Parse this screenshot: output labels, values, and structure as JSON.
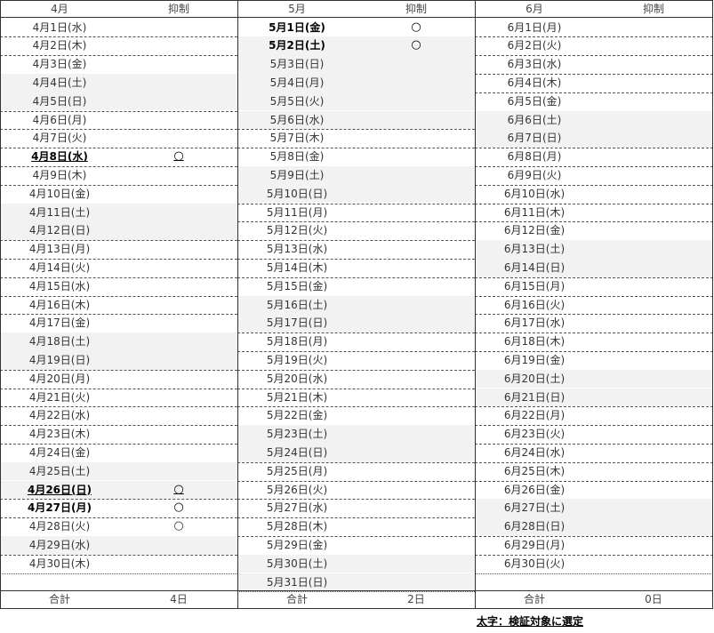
{
  "columns": [
    {
      "header": "4月",
      "sub_header": "抑制",
      "total_label": "合計",
      "total": "4日",
      "days": [
        {
          "d": "4月1日(水)"
        },
        {
          "d": "4月2日(木)"
        },
        {
          "d": "4月3日(金)"
        },
        {
          "d": "4月4日(土)",
          "shade": true
        },
        {
          "d": "4月5日(日)",
          "shade": true
        },
        {
          "d": "4月6日(月)"
        },
        {
          "d": "4月7日(火)"
        },
        {
          "d": "4月8日(水)",
          "mark": "○",
          "bold": true,
          "ul": true
        },
        {
          "d": "4月9日(木)"
        },
        {
          "d": "4月10日(金)"
        },
        {
          "d": "4月11日(土)",
          "shade": true
        },
        {
          "d": "4月12日(日)",
          "shade": true
        },
        {
          "d": "4月13日(月)"
        },
        {
          "d": "4月14日(火)"
        },
        {
          "d": "4月15日(水)"
        },
        {
          "d": "4月16日(木)"
        },
        {
          "d": "4月17日(金)"
        },
        {
          "d": "4月18日(土)",
          "shade": true
        },
        {
          "d": "4月19日(日)",
          "shade": true
        },
        {
          "d": "4月20日(月)"
        },
        {
          "d": "4月21日(火)"
        },
        {
          "d": "4月22日(水)"
        },
        {
          "d": "4月23日(木)"
        },
        {
          "d": "4月24日(金)"
        },
        {
          "d": "4月25日(土)",
          "shade": true
        },
        {
          "d": "4月26日(日)",
          "mark": "○",
          "bold": true,
          "ul": true,
          "shade": true
        },
        {
          "d": "4月27日(月)",
          "mark": "○",
          "bold": true
        },
        {
          "d": "4月28日(火)",
          "mark": "○"
        },
        {
          "d": "4月29日(水)",
          "shade": true
        },
        {
          "d": "4月30日(木)"
        }
      ]
    },
    {
      "header": "5月",
      "sub_header": "抑制",
      "total_label": "合計",
      "total": "2日",
      "days": [
        {
          "d": "5月1日(金)",
          "mark": "○",
          "bold": true
        },
        {
          "d": "5月2日(土)",
          "mark": "○",
          "bold": true,
          "shade": true
        },
        {
          "d": "5月3日(日)",
          "shade": true
        },
        {
          "d": "5月4日(月)",
          "shade": true
        },
        {
          "d": "5月5日(火)",
          "shade": true
        },
        {
          "d": "5月6日(水)",
          "shade": true
        },
        {
          "d": "5月7日(木)"
        },
        {
          "d": "5月8日(金)"
        },
        {
          "d": "5月9日(土)",
          "shade": true
        },
        {
          "d": "5月10日(日)",
          "shade": true
        },
        {
          "d": "5月11日(月)"
        },
        {
          "d": "5月12日(火)"
        },
        {
          "d": "5月13日(水)"
        },
        {
          "d": "5月14日(木)"
        },
        {
          "d": "5月15日(金)"
        },
        {
          "d": "5月16日(土)",
          "shade": true
        },
        {
          "d": "5月17日(日)",
          "shade": true
        },
        {
          "d": "5月18日(月)"
        },
        {
          "d": "5月19日(火)"
        },
        {
          "d": "5月20日(水)"
        },
        {
          "d": "5月21日(木)"
        },
        {
          "d": "5月22日(金)"
        },
        {
          "d": "5月23日(土)",
          "shade": true
        },
        {
          "d": "5月24日(日)",
          "shade": true
        },
        {
          "d": "5月25日(月)"
        },
        {
          "d": "5月26日(火)"
        },
        {
          "d": "5月27日(水)"
        },
        {
          "d": "5月28日(木)"
        },
        {
          "d": "5月29日(金)"
        },
        {
          "d": "5月30日(土)",
          "shade": true
        },
        {
          "d": "5月31日(日)",
          "shade": true
        }
      ]
    },
    {
      "header": "6月",
      "sub_header": "抑制",
      "total_label": "合計",
      "total": "0日",
      "days": [
        {
          "d": "6月1日(月)"
        },
        {
          "d": "6月2日(火)"
        },
        {
          "d": "6月3日(水)"
        },
        {
          "d": "6月4日(木)"
        },
        {
          "d": "6月5日(金)"
        },
        {
          "d": "6月6日(土)",
          "shade": true
        },
        {
          "d": "6月7日(日)",
          "shade": true
        },
        {
          "d": "6月8日(月)"
        },
        {
          "d": "6月9日(火)"
        },
        {
          "d": "6月10日(水)"
        },
        {
          "d": "6月11日(木)"
        },
        {
          "d": "6月12日(金)"
        },
        {
          "d": "6月13日(土)",
          "shade": true
        },
        {
          "d": "6月14日(日)",
          "shade": true
        },
        {
          "d": "6月15日(月)"
        },
        {
          "d": "6月16日(火)"
        },
        {
          "d": "6月17日(水)"
        },
        {
          "d": "6月18日(木)"
        },
        {
          "d": "6月19日(金)"
        },
        {
          "d": "6月20日(土)",
          "shade": true
        },
        {
          "d": "6月21日(日)",
          "shade": true
        },
        {
          "d": "6月22日(月)"
        },
        {
          "d": "6月23日(火)"
        },
        {
          "d": "6月24日(水)"
        },
        {
          "d": "6月25日(木)"
        },
        {
          "d": "6月26日(金)"
        },
        {
          "d": "6月27日(土)",
          "shade": true
        },
        {
          "d": "6月28日(日)",
          "shade": true
        },
        {
          "d": "6月29日(月)"
        },
        {
          "d": "6月30日(火)"
        }
      ]
    }
  ],
  "note": "太字：検証対象に選定",
  "colors": {
    "shade": "#f2f2f2",
    "grid": "#333333",
    "dashed": "#555555"
  }
}
